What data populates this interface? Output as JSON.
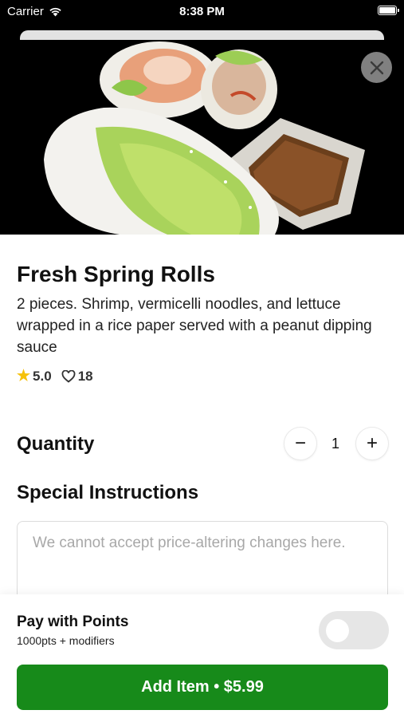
{
  "status_bar": {
    "carrier": "Carrier",
    "time": "8:38 PM"
  },
  "item": {
    "title": "Fresh Spring Rolls",
    "description": "2 pieces. Shrimp, vermicelli noodles, and lettuce wrapped in a rice paper served with a peanut dipping sauce",
    "rating": "5.0",
    "likes": "18"
  },
  "quantity": {
    "label": "Quantity",
    "value": "1",
    "minus_symbol": "−",
    "plus_symbol": "+"
  },
  "special_instructions": {
    "label": "Special Instructions",
    "placeholder": "We cannot accept price-altering changes here."
  },
  "pay_with_points": {
    "title": "Pay with Points",
    "subtitle": "1000pts + modifiers",
    "enabled": false
  },
  "add_button": {
    "label": "Add Item • $5.99"
  },
  "colors": {
    "accent_green": "#178a1a",
    "star": "#f6c20b"
  },
  "icons": [
    "wifi-icon",
    "battery-icon",
    "close-icon",
    "star-icon",
    "heart-icon"
  ]
}
